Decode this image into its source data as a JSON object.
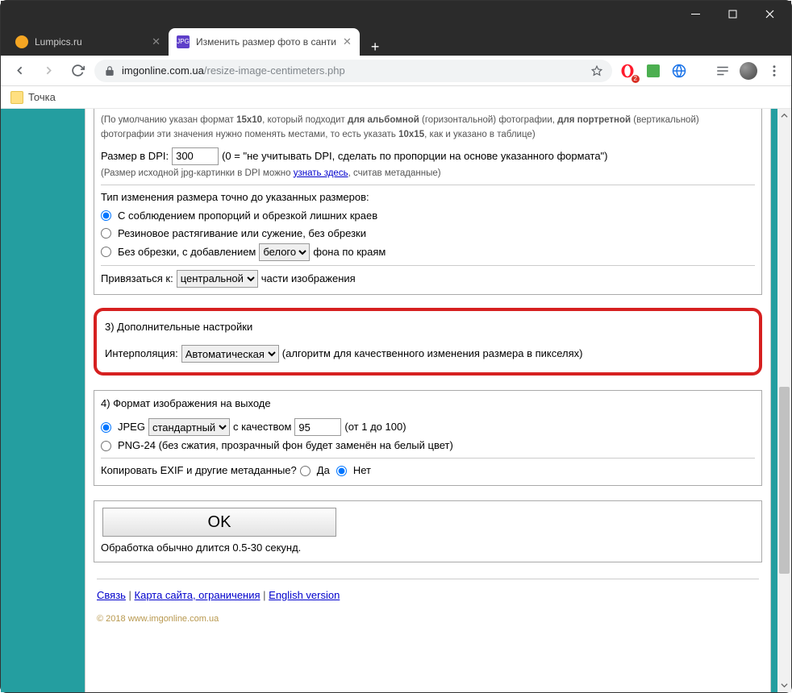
{
  "window": {
    "minimize": "—",
    "maximize": "□",
    "close": "✕"
  },
  "tabs": [
    {
      "title": "Lumpics.ru",
      "active": false,
      "favicon": "#f5a623"
    },
    {
      "title": "Изменить размер фото в санти",
      "active": true,
      "favicon": "#5e3fc9"
    }
  ],
  "bookmark": "Точка",
  "address": {
    "host": "imgonline.com.ua",
    "path": "/resize-image-centimeters.php"
  },
  "extBadge": "2",
  "section1": {
    "hint_a": "(По умолчанию указан формат ",
    "hint_b": "15x10",
    "hint_c": ", который подходит ",
    "hint_d": "для альбомной",
    "hint_e": " (горизонтальной) фотографии, ",
    "hint_f": "для портретной",
    "hint_g": " (вертикальной) фотографии эти значения нужно поменять местами, то есть указать ",
    "hint_h": "10x15",
    "hint_i": ", как и указано в таблице)",
    "dpi_label": "Размер в DPI:",
    "dpi_value": "300",
    "dpi_desc": "(0 = \"не учитывать DPI, сделать по пропорции на основе указанного формата\")",
    "dpi_hint_a": "(Размер исходной jpg-картинки в DPI можно ",
    "dpi_hint_link": "узнать здесь",
    "dpi_hint_b": ", считав метаданные)",
    "type_label": "Тип изменения размера точно до указанных размеров:",
    "opt1": "С соблюдением пропорций и обрезкой лишних краев",
    "opt2": "Резиновое растягивание или сужение, без обрезки",
    "opt3_a": "Без обрезки, с добавлением",
    "opt3_sel": "белого",
    "opt3_b": "фона по краям",
    "bind_a": "Привязаться к:",
    "bind_sel": "центральной",
    "bind_b": "части изображения"
  },
  "section3": {
    "title": "3) Дополнительные настройки",
    "interp_label": "Интерполяция:",
    "interp_sel": "Автоматическая",
    "interp_desc": "(алгоритм для качественного изменения размера в пикселях)"
  },
  "section4": {
    "title": "4) Формат изображения на выходе",
    "jpeg_a": "JPEG",
    "jpeg_sel": "стандартный",
    "jpeg_b": "с качеством",
    "jpeg_val": "95",
    "jpeg_c": "(от 1 до 100)",
    "png": "PNG-24 (без сжатия, прозрачный фон будет заменён на белый цвет)",
    "exif_q": "Копировать EXIF и другие метаданные?",
    "yes": "Да",
    "no": "Нет"
  },
  "submit": {
    "ok": "OK",
    "hint": "Обработка обычно длится 0.5-30 секунд."
  },
  "footer": {
    "link1": "Связь",
    "sep": " | ",
    "link2": "Карта сайта, ограничения",
    "link3": "English version",
    "copy": "© 2018 www.imgonline.com.ua"
  }
}
